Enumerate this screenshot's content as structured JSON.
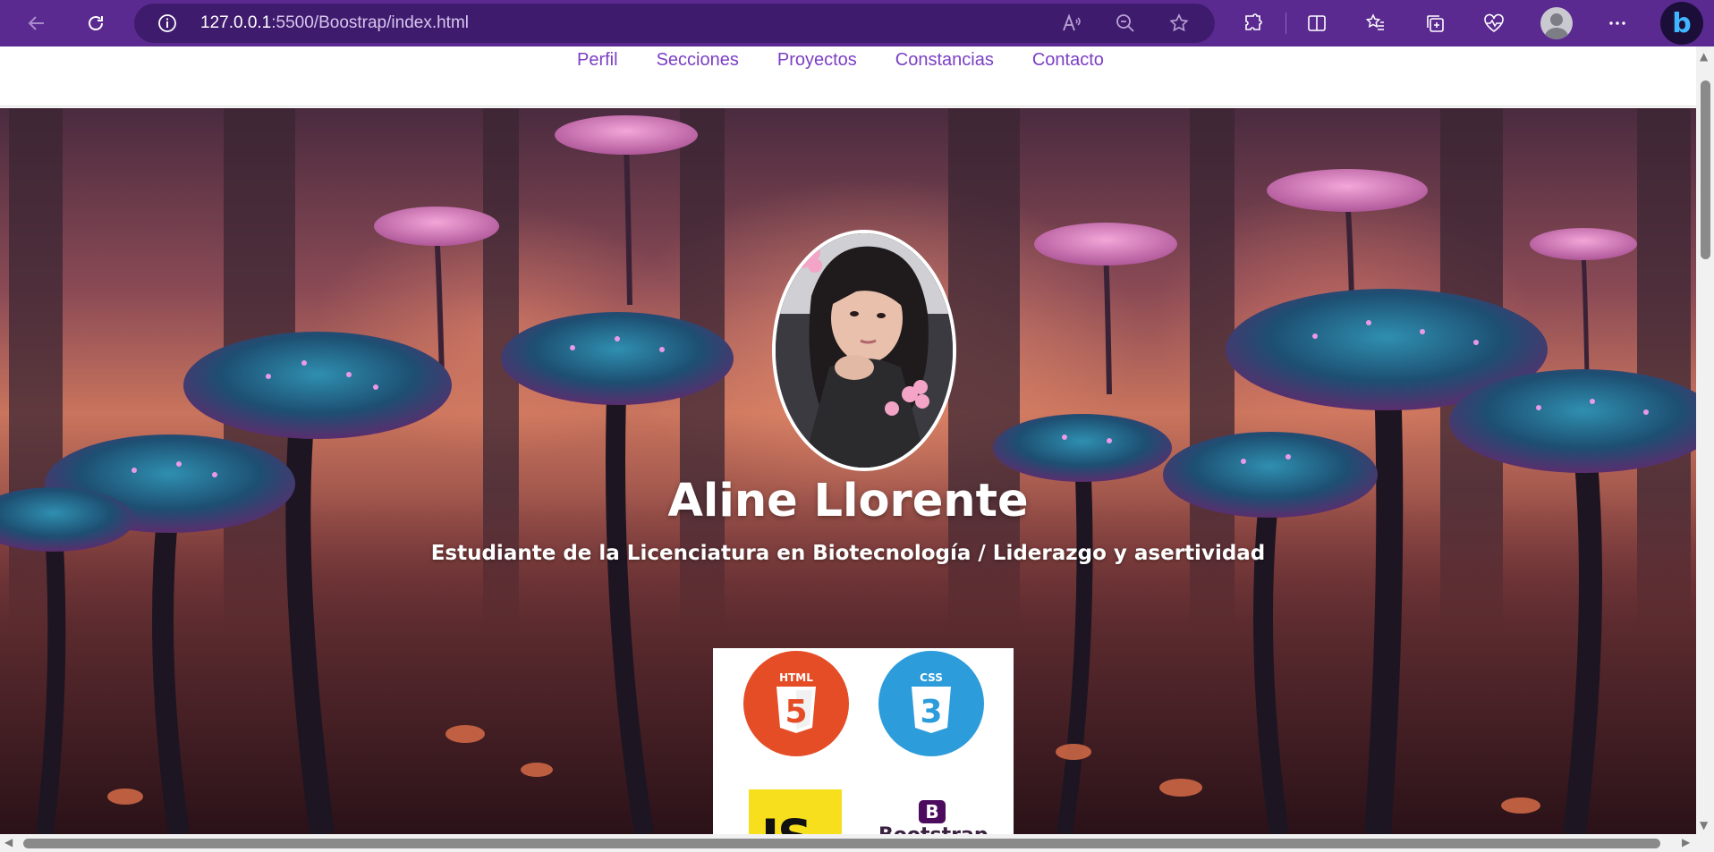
{
  "browser": {
    "url_host": "127.0.0.1",
    "url_path": ":5500/Boostrap/index.html",
    "accent_color": "#5b2a91"
  },
  "nav": {
    "items": [
      {
        "label": "Perfil"
      },
      {
        "label": "Secciones"
      },
      {
        "label": "Proyectos"
      },
      {
        "label": "Constancias"
      },
      {
        "label": "Contacto"
      }
    ],
    "link_color": "#7b3fc4"
  },
  "hero": {
    "name": "Aline Llorente",
    "subtitle": "Estudiante de la Licenciatura en Biotecnología / Liderazgo y asertividad",
    "background": "mushroom-forest-image"
  },
  "logos": [
    {
      "name": "html5-logo",
      "text": "HTML",
      "number": "5",
      "color": "#e44d26"
    },
    {
      "name": "css3-logo",
      "text": "CSS",
      "number": "3",
      "color": "#2d9cdb"
    },
    {
      "name": "javascript-logo",
      "text": "JS",
      "color": "#f7df1e"
    },
    {
      "name": "bootstrap-logo",
      "text": "Bootstrap",
      "letter": "B",
      "color": "#4c0b5f"
    }
  ]
}
